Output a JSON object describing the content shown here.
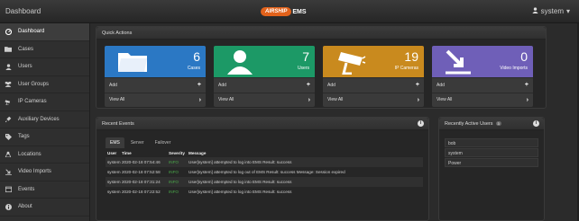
{
  "topbar": {
    "title": "Dashboard",
    "logo_mark": "AIRSHIP",
    "logo_suffix": "EMS",
    "user": "system"
  },
  "sidebar": {
    "items": [
      {
        "label": "Dashboard",
        "icon": "dashboard-icon"
      },
      {
        "label": "Cases",
        "icon": "folder-icon"
      },
      {
        "label": "Users",
        "icon": "user-icon"
      },
      {
        "label": "User Groups",
        "icon": "users-icon"
      },
      {
        "label": "IP Cameras",
        "icon": "camera-icon"
      },
      {
        "label": "Auxiliary Devices",
        "icon": "plug-icon"
      },
      {
        "label": "Tags",
        "icon": "tag-icon"
      },
      {
        "label": "Locations",
        "icon": "location-icon"
      },
      {
        "label": "Video Imports",
        "icon": "import-icon"
      },
      {
        "label": "Events",
        "icon": "events-icon"
      },
      {
        "label": "About",
        "icon": "info-icon"
      }
    ]
  },
  "quick_actions": {
    "title": "Quick Actions",
    "cards": [
      {
        "count": "6",
        "label": "Cases",
        "add": "Add",
        "view": "View All",
        "color": "#2b78c4",
        "icon": "folder-icon"
      },
      {
        "count": "7",
        "label": "Users",
        "add": "Add",
        "view": "View All",
        "color": "#1c9966",
        "icon": "user-icon"
      },
      {
        "count": "19",
        "label": "IP Cameras",
        "add": "Add",
        "view": "View All",
        "color": "#c98a1e",
        "icon": "camera-icon"
      },
      {
        "count": "0",
        "label": "Video Imports",
        "add": "Add",
        "view": "View All",
        "color": "#6f5fb8",
        "icon": "import-icon"
      }
    ]
  },
  "recent_events": {
    "title": "Recent Events",
    "tabs": [
      "EMS",
      "Server",
      "Failover"
    ],
    "columns": [
      "User",
      "Time",
      "Severity",
      "Message"
    ],
    "rows": [
      {
        "user": "system",
        "time": "2020-02-18 07:54:46",
        "severity": "INFO",
        "message": "User[system] attempted to log into EMS Result: success"
      },
      {
        "user": "system",
        "time": "2020-02-18 07:52:58",
        "severity": "INFO",
        "message": "User[system] attempted to log out of EMS Result: success Message: Session expired"
      },
      {
        "user": "system",
        "time": "2020-02-18 07:31:24",
        "severity": "INFO",
        "message": "User[system] attempted to log into EMS Result: success"
      },
      {
        "user": "system",
        "time": "2020-02-18 07:22:52",
        "severity": "INFO",
        "message": "User[system] attempted to log into EMS Result: success"
      }
    ]
  },
  "recently_active": {
    "title": "Recently Active Users",
    "count": "3",
    "users": [
      "bob",
      "system",
      "Power"
    ]
  }
}
